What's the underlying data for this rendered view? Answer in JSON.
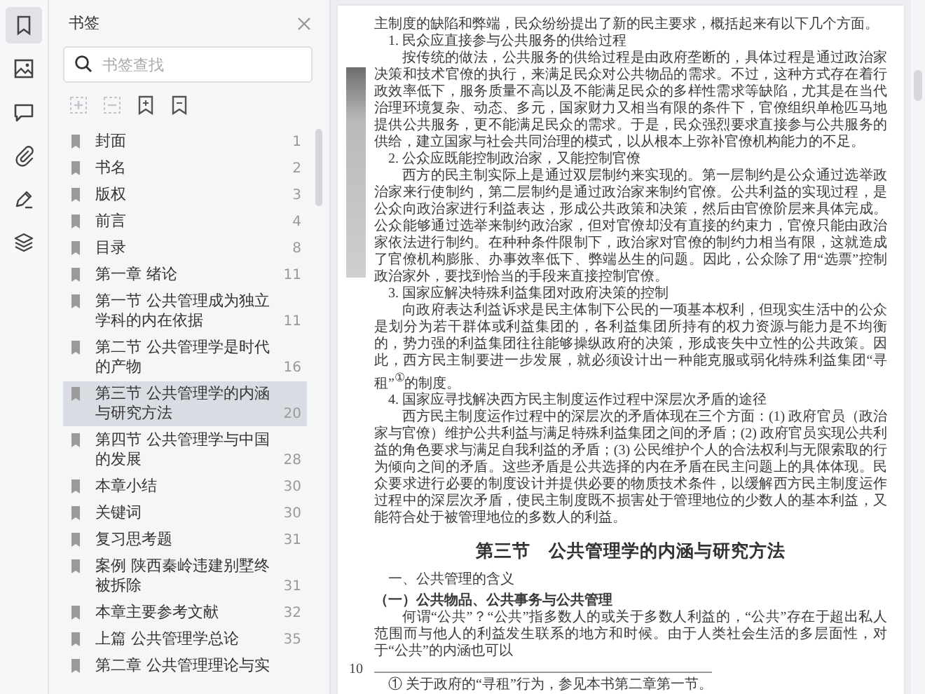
{
  "rail": [
    {
      "selected": true
    },
    {
      "selected": false
    },
    {
      "selected": false
    },
    {
      "selected": false
    },
    {
      "selected": false
    },
    {
      "selected": false
    }
  ],
  "sidebar": {
    "title": "书签",
    "search": {
      "placeholder": "书签查找"
    },
    "tools": [
      {
        "disabled": true
      },
      {
        "disabled": true
      },
      {
        "disabled": false
      },
      {
        "disabled": false
      }
    ],
    "bookmarks": [
      {
        "label": "封面",
        "page": "1",
        "selected": false
      },
      {
        "label": "书名",
        "page": "2",
        "selected": false
      },
      {
        "label": "版权",
        "page": "3",
        "selected": false
      },
      {
        "label": "前言",
        "page": "4",
        "selected": false
      },
      {
        "label": "目录",
        "page": "8",
        "selected": false
      },
      {
        "label": "第一章 绪论",
        "page": "11",
        "selected": false
      },
      {
        "label": "第一节 公共管理成为独立学科的内在依据",
        "page": "11",
        "selected": false
      },
      {
        "label": "第二节 公共管理学是时代的产物",
        "page": "16",
        "selected": false
      },
      {
        "label": "第三节 公共管理学的内涵与研究方法",
        "page": "20",
        "selected": true
      },
      {
        "label": "第四节 公共管理学与中国的发展",
        "page": "28",
        "selected": false
      },
      {
        "label": "本章小结",
        "page": "30",
        "selected": false
      },
      {
        "label": "关键词",
        "page": "30",
        "selected": false
      },
      {
        "label": "复习思考题",
        "page": "31",
        "selected": false
      },
      {
        "label": "案例 陕西秦岭违建别墅终被拆除",
        "page": "31",
        "selected": false
      },
      {
        "label": "本章主要参考文献",
        "page": "32",
        "selected": false
      },
      {
        "label": "上篇 公共管理学总论",
        "page": "35",
        "selected": false
      },
      {
        "label": "第二章 公共管理理论与实",
        "selected": false
      }
    ]
  },
  "page": {
    "page_number": "10",
    "blocks": [
      {
        "kind": "para_cont",
        "text": "主制度的缺陷和弊端，民众纷纷提出了新的民主要求，概括起来有以下几个方面。"
      },
      {
        "kind": "item",
        "text": "1. 民众应直接参与公共服务的供给过程"
      },
      {
        "kind": "para",
        "text": "按传统的做法，公共服务的供给过程是由政府垄断的，具体过程是通过政治家决策和技术官僚的执行，来满足民众对公共物品的需求。不过，这种方式存在着行政效率低下，服务质量不高以及不能满足民众的多样性需求等缺陷，尤其是在当代治理环境复杂、动态、多元，国家财力又相当有限的条件下，官僚组织单枪匹马地提供公共服务，更不能满足民众的需求。于是，民众强烈要求直接参与公共服务的供给，建立国家与社会共同治理的模式，以从根本上弥补官僚机构能力的不足。"
      },
      {
        "kind": "item",
        "text": "2. 公众应既能控制政治家，又能控制官僚"
      },
      {
        "kind": "para",
        "text": "西方的民主制实际上是通过双层制约来实现的。第一层制约是公众通过选举政治家来行使制约，第二层制约是通过政治家来制约官僚。公共利益的实现过程，是公众向政治家进行利益表达，形成公共政策和决策，然后由官僚阶层来具体完成。公众能够通过选举来制约政治家，但对官僚却没有直接的约束力，官僚只能由政治家依法进行制约。在种种条件限制下，政治家对官僚的制约力相当有限，这就造成了官僚机构膨胀、办事效率低下、弊端丛生的问题。因此，公众除了用“选票”控制政治家外，要找到恰当的手段来直接控制官僚。"
      },
      {
        "kind": "item",
        "text": "3. 国家应解决特殊利益集团对政府决策的控制"
      },
      {
        "kind": "para",
        "text": "向政府表达利益诉求是民主体制下公民的一项基本权利，但现实生活中的公众是划分为若干群体或利益集团的，各利益集团所持有的权力资源与能力是不均衡的，势力强的利益集团往往能够操纵政府的决策，形成丧失中立性的公共政策。因此，西方民主制要进一步发展，就必须设计出一种能克服或弱化特殊利益集团“寻租”$^{①}$的制度。"
      },
      {
        "kind": "item",
        "text": "4. 国家应寻找解决西方民主制度运作过程中深层次矛盾的途径"
      },
      {
        "kind": "para",
        "text": "西方民主制度运作过程中的深层次的矛盾体现在三个方面：(1) 政府官员（政治家与官僚）维护公共利益与满足特殊利益集团之间的矛盾；(2) 政府官员实现公共利益的角色要求与满足自我利益的矛盾；(3) 公民维护个人的合法权利与无限索取的行为倾向之间的矛盾。这些矛盾是公共选择的内在矛盾在民主问题上的具体体现。民众要求进行必要的制度设计并提供必要的物质技术条件，以缓解西方民主制度运作过程中的深层次矛盾，使民主制度既不损害处于管理地位的少数人的基本利益，又能符合处于被管理地位的多数人的利益。"
      },
      {
        "kind": "title",
        "text": "第三节　公共管理学的内涵与研究方法"
      },
      {
        "kind": "section",
        "text": "一、公共管理的含义"
      },
      {
        "kind": "subsection",
        "text": "（一）公共物品、公共事务与公共管理"
      },
      {
        "kind": "para",
        "text": "何谓“公共”？“公共”指多数人的或关于多数人利益的，“公共”存在于超出私人范围而与他人的利益发生联系的地方和时候。由于人类社会生活的多层面性，对于“公共”的内涵也可以"
      },
      {
        "kind": "footnote",
        "text": "① 关于政府的“寻租”行为，参见本书第二章第一节。"
      }
    ]
  }
}
